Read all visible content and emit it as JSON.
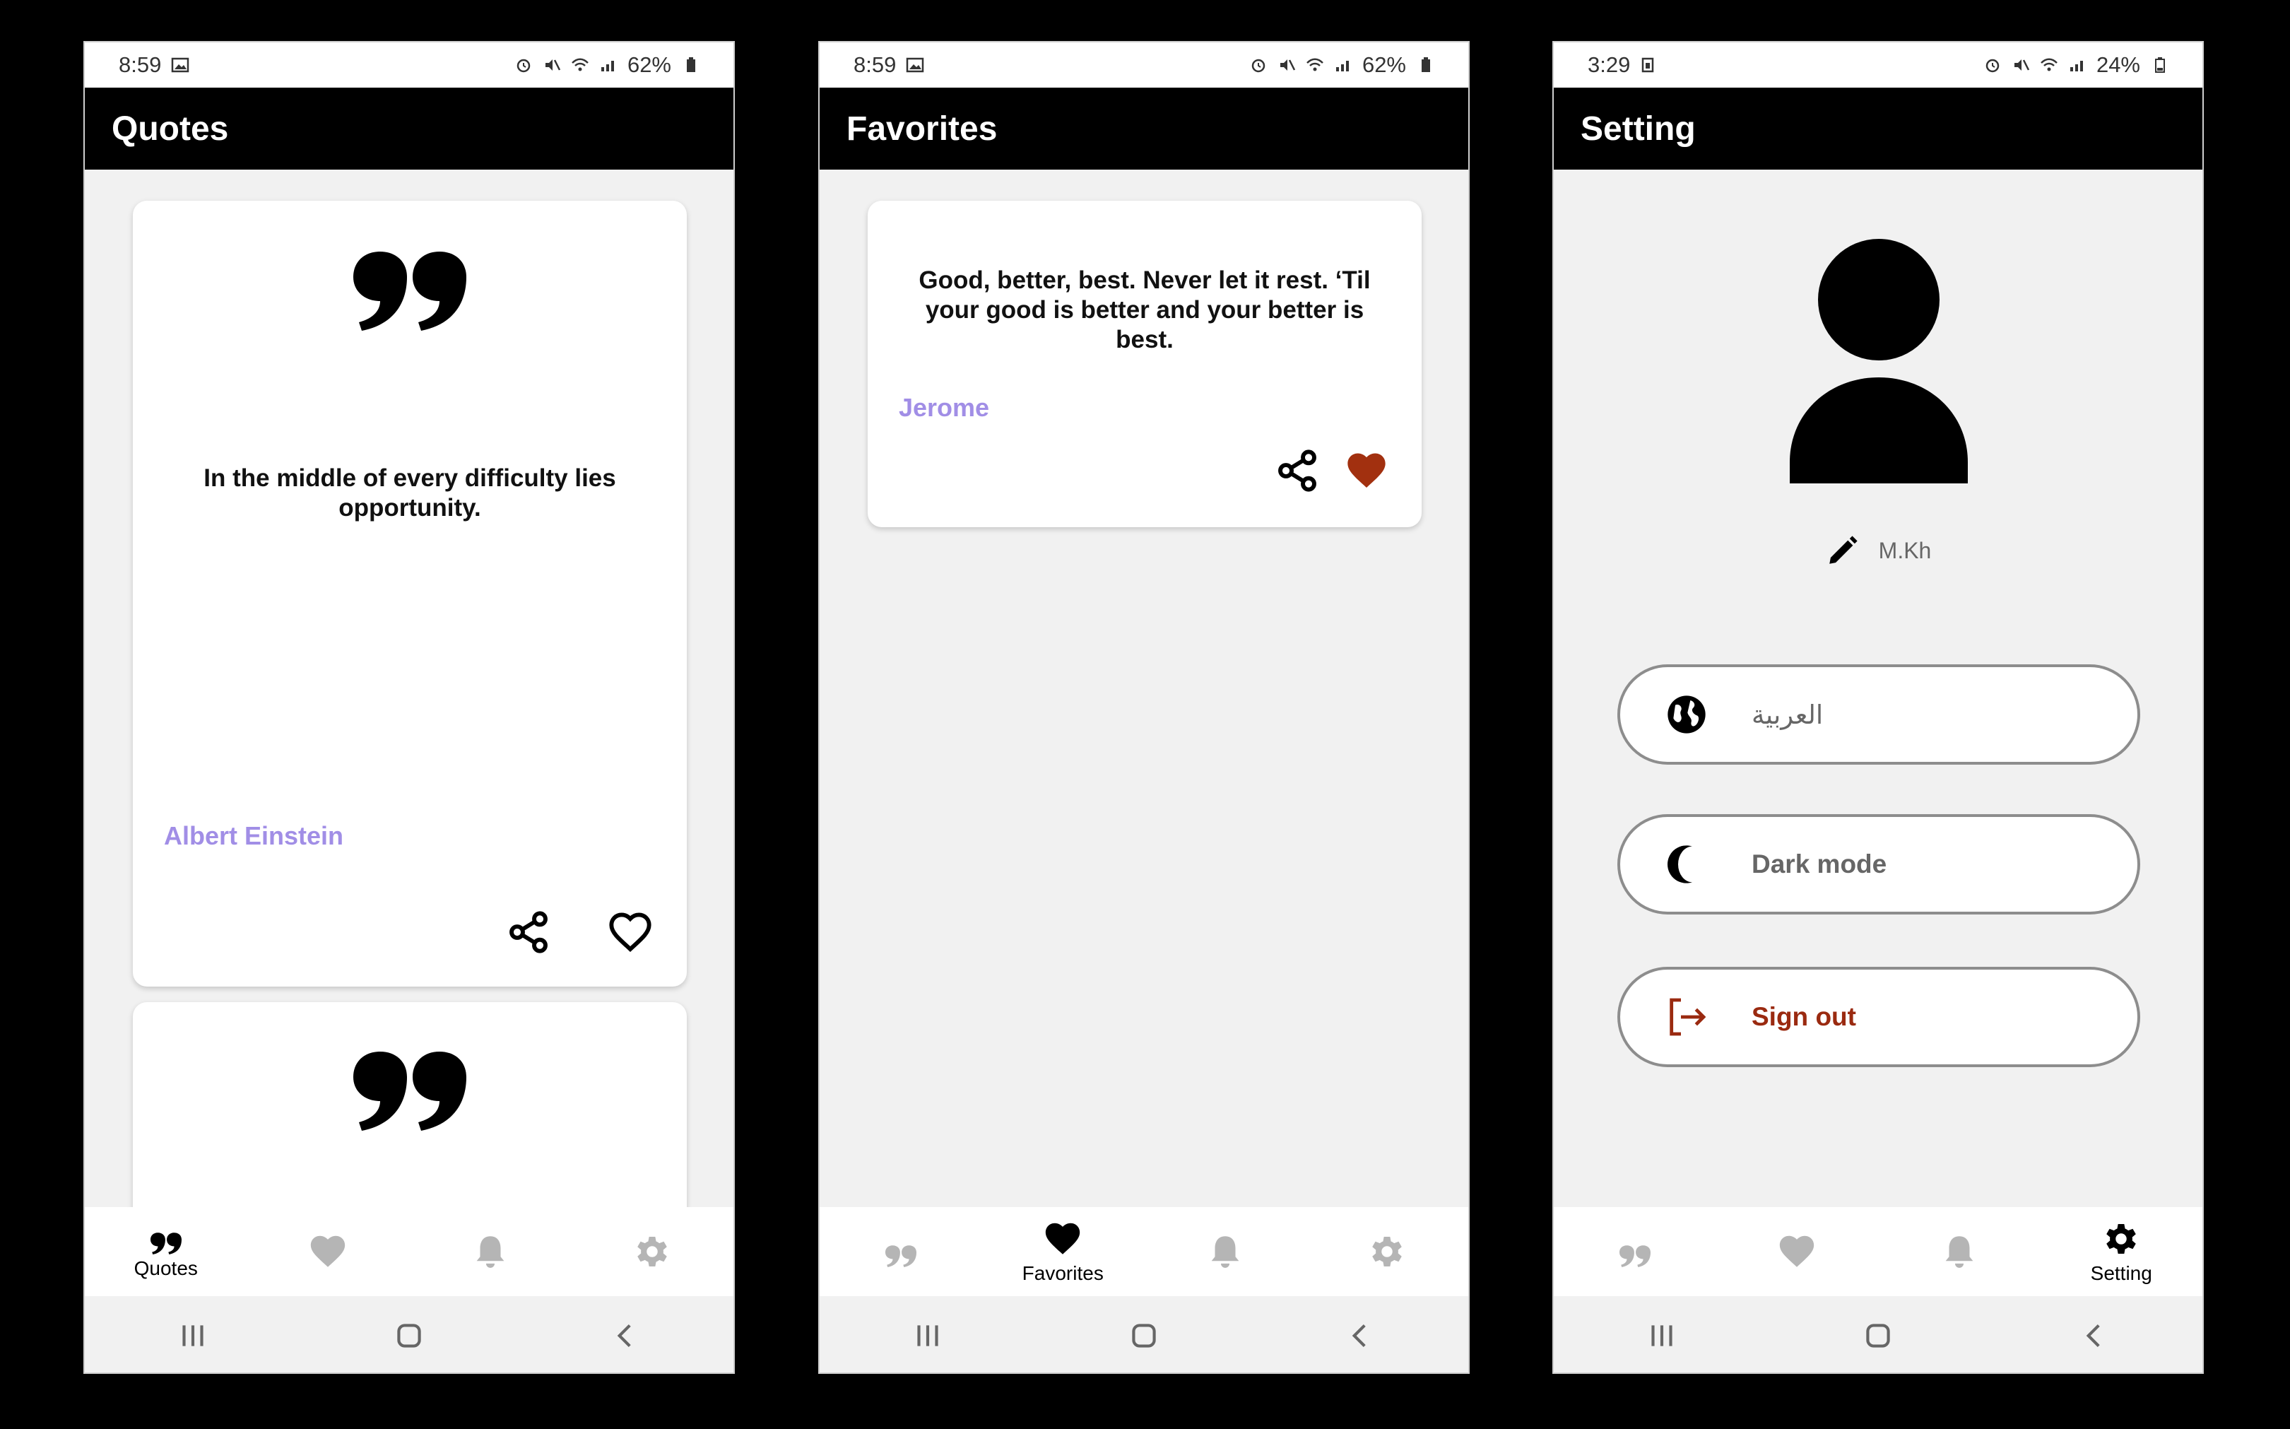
{
  "colors": {
    "author": "#a18ee6",
    "favorite_active": "#a2300f",
    "signout": "#9a2a10",
    "nav_inactive": "#b5b5b5"
  },
  "phones": [
    {
      "status": {
        "time": "8:59",
        "battery": "62%"
      },
      "title": "Quotes",
      "cards": [
        {
          "quote": "In the middle of every difficulty lies opportunity.",
          "author": "Albert Einstein",
          "favorited": false
        }
      ],
      "active_tab": "Quotes"
    },
    {
      "status": {
        "time": "8:59",
        "battery": "62%"
      },
      "title": "Favorites",
      "cards": [
        {
          "quote": "Good, better, best. Never let it rest. ‘Til your good is better and your better is best.",
          "author": "Jerome",
          "favorited": true
        }
      ],
      "active_tab": "Favorites"
    },
    {
      "status": {
        "time": "3:29",
        "battery": "24%"
      },
      "title": "Setting",
      "profile": {
        "username": "M.Kh"
      },
      "options": [
        {
          "label": "العربية",
          "icon": "globe-icon"
        },
        {
          "label": "Dark mode",
          "icon": "moon-icon"
        },
        {
          "label": "Sign out",
          "icon": "logout-icon"
        }
      ],
      "active_tab": "Setting"
    }
  ],
  "nav": {
    "quotes_label": "Quotes",
    "favorites_label": "Favorites",
    "notifications_label": "",
    "setting_label": "Setting"
  }
}
